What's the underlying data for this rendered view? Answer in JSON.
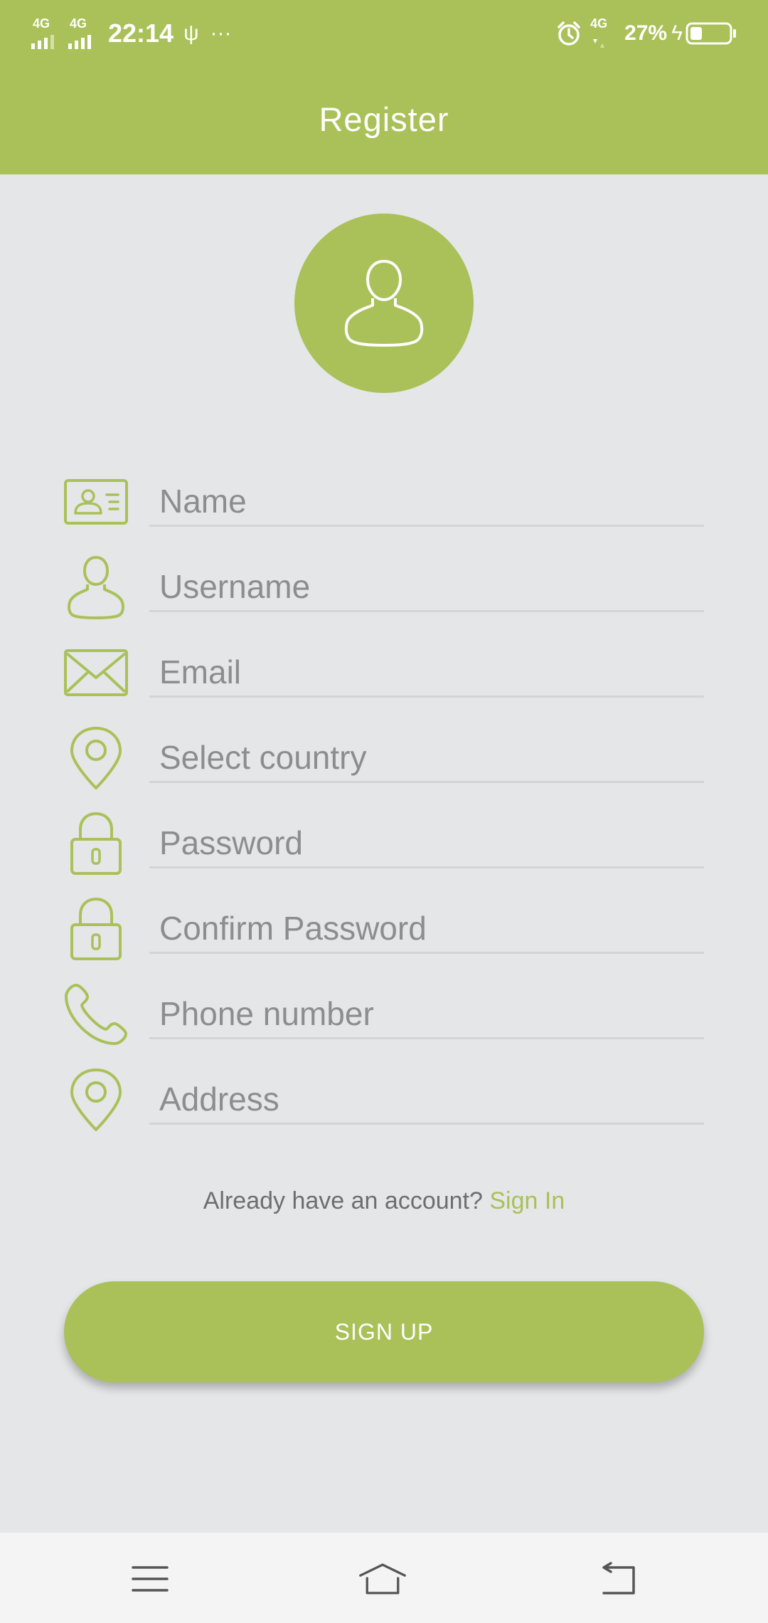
{
  "status_bar": {
    "signal1_label": "4G",
    "signal2_label": "4G",
    "time": "22:14",
    "usb_glyph": "ψ",
    "more_glyph": "···",
    "alarm_icon": "alarm-icon",
    "signal3_label": "4G",
    "battery_percent": "27%",
    "charging_glyph": "ϟ"
  },
  "header": {
    "title": "Register"
  },
  "form": {
    "fields": [
      {
        "placeholder": "Name",
        "icon": "id-card-icon"
      },
      {
        "placeholder": "Username",
        "icon": "user-icon"
      },
      {
        "placeholder": "Email",
        "icon": "envelope-icon"
      },
      {
        "placeholder": "Select country",
        "icon": "location-pin-icon"
      },
      {
        "placeholder": "Password",
        "icon": "lock-icon"
      },
      {
        "placeholder": "Confirm Password",
        "icon": "lock-icon"
      },
      {
        "placeholder": "Phone number",
        "icon": "phone-icon"
      },
      {
        "placeholder": "Address",
        "icon": "location-pin-icon"
      }
    ]
  },
  "signin": {
    "prompt": "Already have an account?",
    "link": "Sign In"
  },
  "signup_button": "SIGN UP",
  "colors": {
    "accent": "#a9c158",
    "background": "#e5e6e8",
    "placeholder": "#8d8d8f",
    "divider": "#d3d4d6",
    "nav_bar": "#f4f4f5"
  }
}
